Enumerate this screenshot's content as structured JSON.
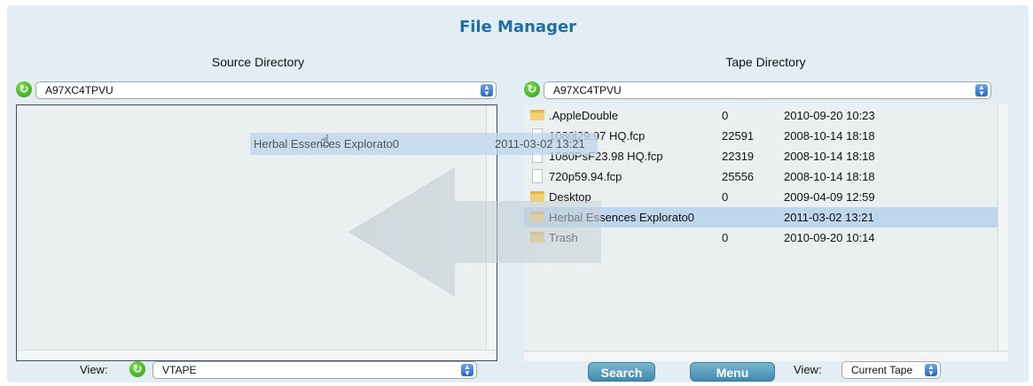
{
  "app": {
    "title": "File Manager"
  },
  "source": {
    "title": "Source Directory",
    "directory_select": "A97XC4TPVU",
    "view_label": "View:",
    "view_select": "VTAPE"
  },
  "tape": {
    "title": "Tape Directory",
    "directory_select": "A97XC4TPVU",
    "rows": [
      {
        "type": "folder",
        "name": ".AppleDouble",
        "size": "0",
        "date": "2010-09-20 10:23",
        "selected": false
      },
      {
        "type": "file",
        "name": "1080i29.97 HQ.fcp",
        "size": "22591",
        "date": "2008-10-14 18:18",
        "selected": false
      },
      {
        "type": "file",
        "name": "1080PsF23.98 HQ.fcp",
        "size": "22319",
        "date": "2008-10-14 18:18",
        "selected": false
      },
      {
        "type": "file",
        "name": "720p59.94.fcp",
        "size": "25556",
        "date": "2008-10-14 18:18",
        "selected": false
      },
      {
        "type": "folder",
        "name": "Desktop",
        "size": "0",
        "date": "2009-04-09 12:59",
        "selected": false
      },
      {
        "type": "folder",
        "name": "Herbal Essences Explorato0",
        "size": "",
        "date": "2011-03-02 13:21",
        "selected": true
      },
      {
        "type": "folder",
        "name": "Trash",
        "size": "0",
        "date": "2010-09-20 10:14",
        "selected": false
      }
    ],
    "search_button": "Search",
    "menu_button": "Menu",
    "view_label": "View:",
    "view_select": "Current Tape"
  },
  "drag": {
    "name": "Herbal Essences Explorato0",
    "date": "2011-03-02 13:21"
  },
  "colors": {
    "accent": "#1f6fa5",
    "selection": "#bed7ec",
    "button": "#4f94b8"
  }
}
